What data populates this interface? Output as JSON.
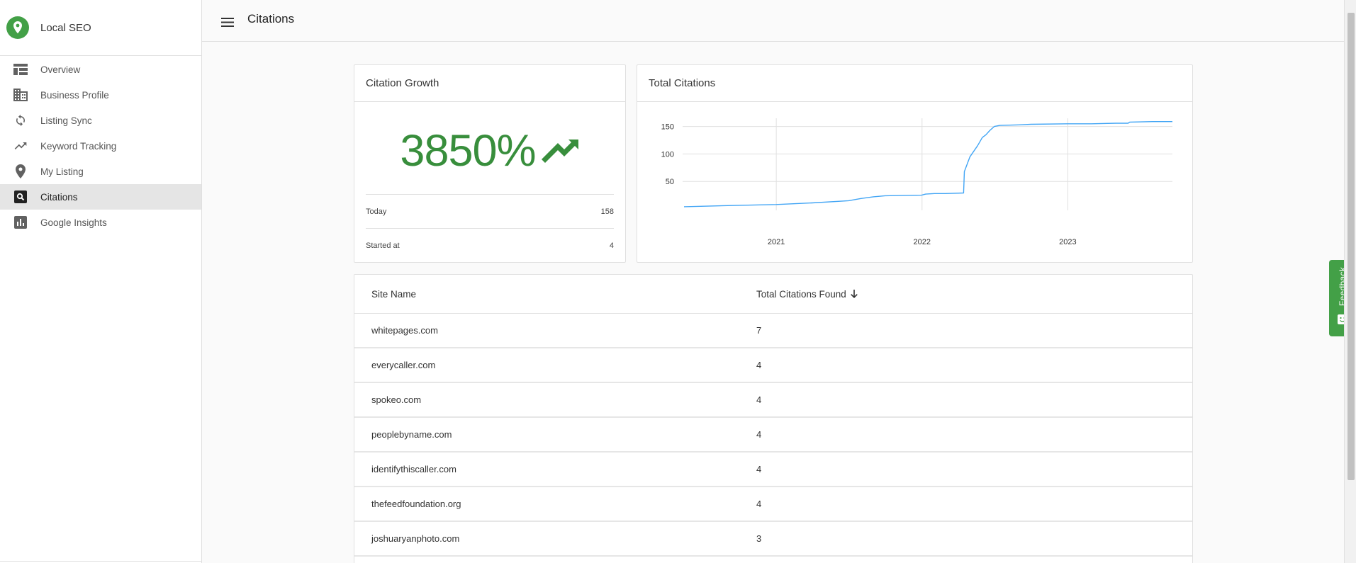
{
  "app": {
    "name": "Local SEO"
  },
  "sidebar": {
    "items": [
      {
        "label": "Overview",
        "icon": "overview-icon",
        "active": false
      },
      {
        "label": "Business Profile",
        "icon": "business-icon",
        "active": false
      },
      {
        "label": "Listing Sync",
        "icon": "sync-icon",
        "active": false
      },
      {
        "label": "Keyword Tracking",
        "icon": "trending-icon",
        "active": false
      },
      {
        "label": "My Listing",
        "icon": "location-pin-icon",
        "active": false
      },
      {
        "label": "Citations",
        "icon": "search-box-icon",
        "active": true
      },
      {
        "label": "Google Insights",
        "icon": "bar-chart-icon",
        "active": false
      }
    ]
  },
  "header": {
    "title": "Citations"
  },
  "growth": {
    "title": "Citation Growth",
    "value": "3850%",
    "today_label": "Today",
    "today_value": "158",
    "started_label": "Started at",
    "started_value": "4"
  },
  "total": {
    "title": "Total Citations"
  },
  "chart_data": {
    "type": "line",
    "title": "Total Citations",
    "xlabel": "",
    "ylabel": "",
    "x_ticks": [
      "2021",
      "2022",
      "2023"
    ],
    "y_ticks": [
      50,
      100,
      150
    ],
    "ylim": [
      0,
      165
    ],
    "xlim": [
      "2020-05-15",
      "2023-09-20"
    ],
    "grid": true,
    "color": "#42a5f5",
    "series": [
      {
        "x": [
          "2020-05-15",
          "2020-09-01",
          "2021-01-01",
          "2021-04-01",
          "2021-07-01",
          "2021-08-01",
          "2021-09-01",
          "2021-10-01",
          "2021-12-31",
          "2022-01-10",
          "2022-02-01",
          "2022-03-01",
          "2022-04-15",
          "2022-04-17",
          "2022-05-01",
          "2022-05-20",
          "2022-06-01",
          "2022-06-10",
          "2022-06-20",
          "2022-07-01",
          "2022-07-15",
          "2022-09-01",
          "2022-10-01",
          "2022-12-31",
          "2023-03-01",
          "2023-05-01",
          "2023-06-01",
          "2023-06-05",
          "2023-08-01",
          "2023-09-20"
        ],
        "y": [
          4,
          6,
          8,
          11,
          15,
          19,
          22,
          24,
          25,
          27,
          28,
          28,
          29,
          68,
          95,
          115,
          130,
          135,
          143,
          150,
          152,
          153,
          154,
          155,
          155,
          156,
          156,
          158,
          159,
          159
        ]
      }
    ]
  },
  "table": {
    "headers": [
      "Site Name",
      "Total Citations Found"
    ],
    "rows": [
      [
        "whitepages.com",
        "7"
      ],
      [
        "everycaller.com",
        "4"
      ],
      [
        "spokeo.com",
        "4"
      ],
      [
        "peoplebyname.com",
        "4"
      ],
      [
        "identifythiscaller.com",
        "4"
      ],
      [
        "thefeedfoundation.org",
        "4"
      ],
      [
        "joshuaryanphoto.com",
        "3"
      ]
    ]
  },
  "feedback": {
    "label": "Feedback"
  },
  "colors": {
    "brand_green": "#43a047",
    "growth_green": "#388e3c",
    "line_blue": "#42a5f5"
  }
}
